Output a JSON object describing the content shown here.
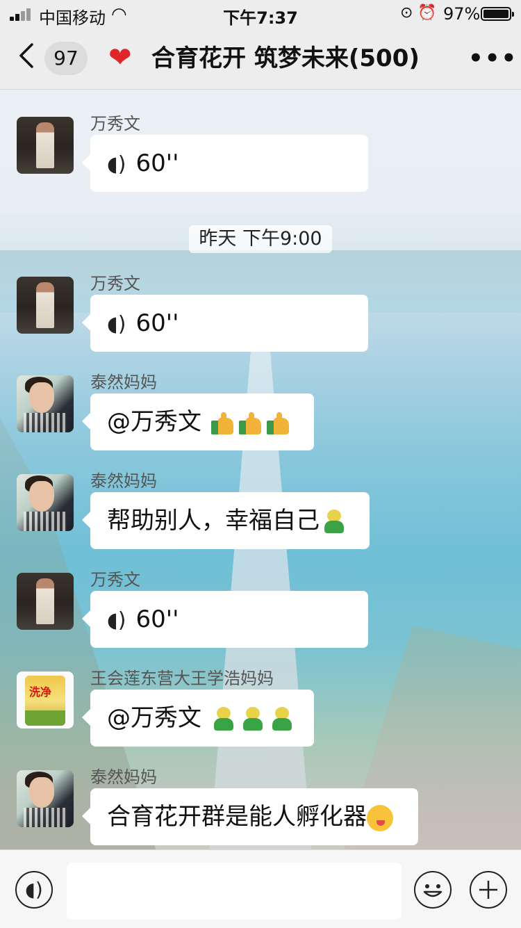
{
  "status_bar": {
    "carrier": "中国移动",
    "time": "下午7:37",
    "battery_percent": "97%",
    "battery_level": 0.97
  },
  "nav": {
    "back_count": "97",
    "title": "合育花开 筑梦未来(500)",
    "more_label": "•••"
  },
  "timestamps": [
    "昨天 下午9:00"
  ],
  "messages": [
    {
      "sender": "万秀文",
      "type": "voice",
      "text": "60''"
    },
    {
      "sender": "万秀文",
      "type": "voice",
      "text": "60''"
    },
    {
      "sender": "泰然妈妈",
      "type": "text",
      "text": "@万秀文 "
    },
    {
      "sender": "泰然妈妈",
      "type": "text",
      "text": "帮助别人，幸福自己"
    },
    {
      "sender": "万秀文",
      "type": "voice",
      "text": "60''"
    },
    {
      "sender": "王会莲东营大王学浩妈妈",
      "type": "text",
      "text": "@万秀文 "
    },
    {
      "sender": "泰然妈妈",
      "type": "text",
      "text": "合育花开群是能人孵化器"
    }
  ],
  "avatar_badge_text": "洗净",
  "input_bar": {
    "placeholder": ""
  },
  "colors": {
    "nav_bg": "#ededed",
    "bubble_bg": "#ffffff",
    "heart": "#e0262b",
    "input_bar_bg": "#f6f6f6"
  },
  "icons": {
    "back": "chevron-left-icon",
    "heart": "heart-icon",
    "more": "more-icon",
    "voice": "voice-icon",
    "emoji": "emoji-icon",
    "plus": "plus-icon"
  }
}
